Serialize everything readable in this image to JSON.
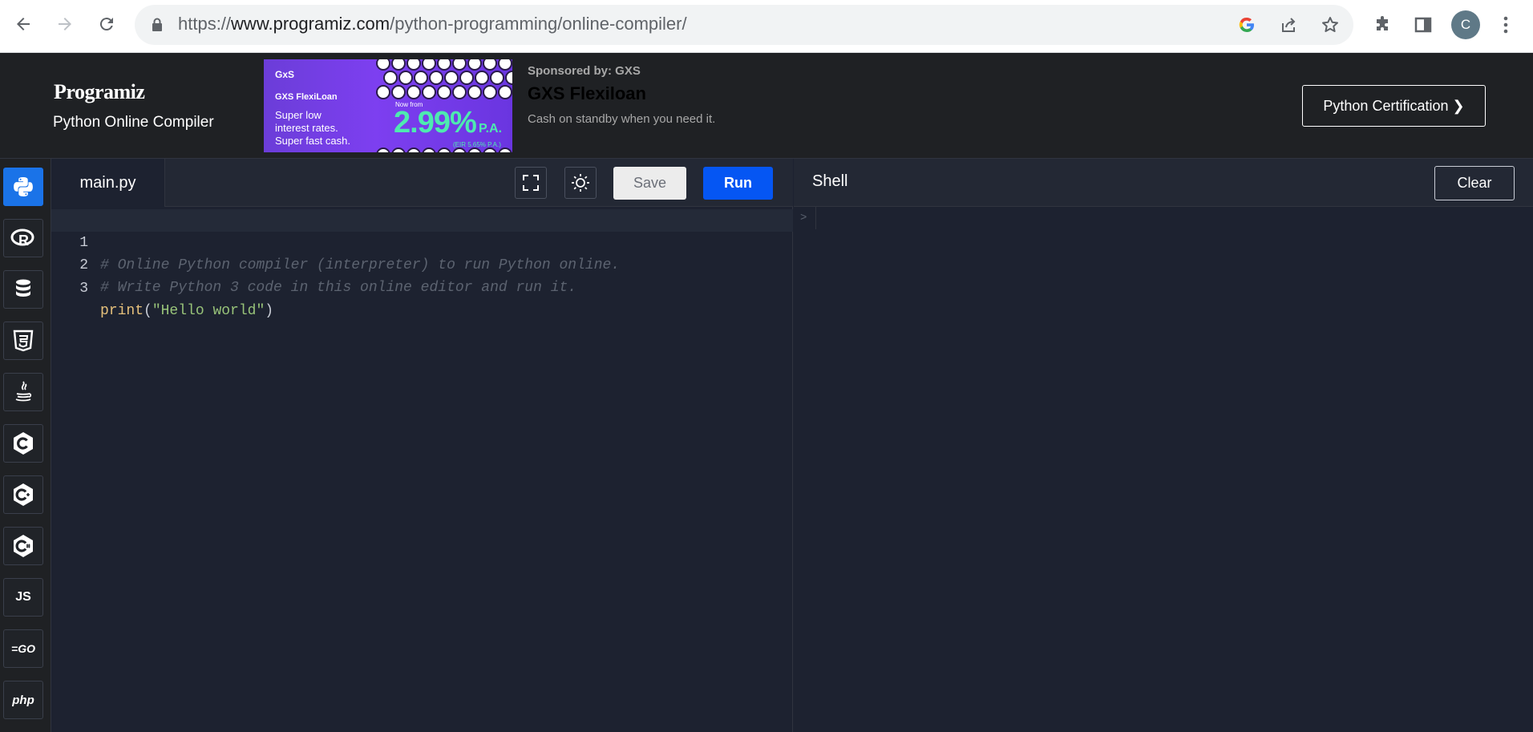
{
  "browser": {
    "url_prefix": "https://",
    "url_host": "www.programiz.com",
    "url_path": "/python-programming/online-compiler/",
    "avatar_letter": "C"
  },
  "header": {
    "logo": "Programiz",
    "subtitle": "Python Online Compiler",
    "certification_button": "Python Certification ❯"
  },
  "ad": {
    "brand": "GxS",
    "product": "GXS FlexiLoan",
    "tagline_lines": [
      "Super low",
      "interest rates.",
      "Super fast cash."
    ],
    "now_from": "Now from",
    "rate": "2.99%",
    "rate_suffix": "P.A.",
    "eir": "(EIR 5.65% P.A.)",
    "sponsored": "Sponsored by: GXS",
    "title": "GXS Flexiloan",
    "description": "Cash on standby when you need it."
  },
  "languages": [
    {
      "name": "python",
      "label": "",
      "icon": "python-icon"
    },
    {
      "name": "r",
      "label": "R",
      "icon": "r-icon"
    },
    {
      "name": "sql",
      "label": "",
      "icon": "database-icon"
    },
    {
      "name": "html",
      "label": "5",
      "icon": "html5-icon"
    },
    {
      "name": "java",
      "label": "",
      "icon": "java-icon"
    },
    {
      "name": "c",
      "label": "C",
      "icon": "c-icon"
    },
    {
      "name": "cpp",
      "label": "C+",
      "icon": "cpp-icon"
    },
    {
      "name": "csharp",
      "label": "C#",
      "icon": "csharp-icon"
    },
    {
      "name": "js",
      "label": "JS",
      "icon": "js-icon"
    },
    {
      "name": "go",
      "label": "=GO",
      "icon": "go-icon"
    },
    {
      "name": "php",
      "label": "php",
      "icon": "php-icon"
    }
  ],
  "editor": {
    "file_tab": "main.py",
    "save_label": "Save",
    "run_label": "Run",
    "line_numbers": [
      "1",
      "2",
      "3"
    ],
    "line1": "# Online Python compiler (interpreter) to run Python online.",
    "line2": "# Write Python 3 code in this online editor and run it.",
    "line3_fn": "print",
    "line3_open": "(",
    "line3_str": "\"Hello world\"",
    "line3_close": ")"
  },
  "shell": {
    "title": "Shell",
    "clear_label": "Clear",
    "prompt": ">"
  }
}
